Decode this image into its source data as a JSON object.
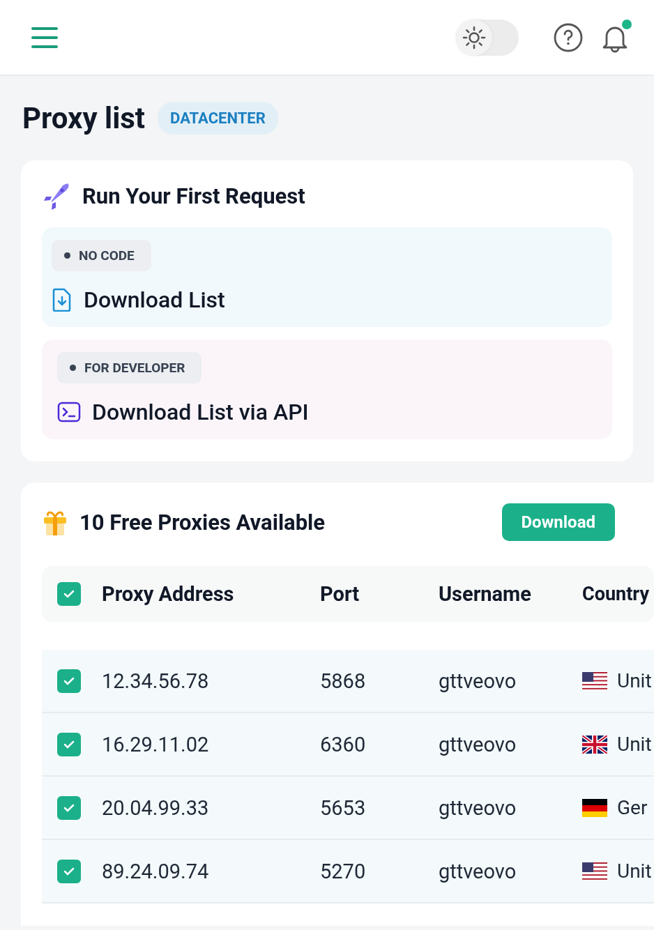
{
  "header": {
    "dark_mode": false,
    "notification_unread": true
  },
  "page_title": "Proxy list",
  "page_badge": "DATACENTER",
  "first_request": {
    "title": "Run Your First Request",
    "options": [
      {
        "kind": "file",
        "tag": "NO CODE",
        "label": "Download List"
      },
      {
        "kind": "api",
        "tag": "FOR DEVELOPER",
        "label": "Download List via API"
      }
    ]
  },
  "free_proxies": {
    "title": "10 Free Proxies Available",
    "download_button": "Download",
    "table": {
      "select_all": {
        "checked": true
      },
      "columns": [
        "Proxy Address",
        "Port",
        "Username",
        "Country"
      ],
      "rows": [
        {
          "checked": true,
          "address": "12.34.56.78",
          "port": "5868",
          "username": "gttveovo",
          "kind": "us",
          "country": "Unit"
        },
        {
          "checked": true,
          "address": "16.29.11.02",
          "port": "6360",
          "username": "gttveovo",
          "kind": "uk",
          "country": "Unit"
        },
        {
          "checked": true,
          "address": "20.04.99.33",
          "port": "5653",
          "username": "gttveovo",
          "kind": "de",
          "country": "Ger"
        },
        {
          "checked": true,
          "address": "89.24.09.74",
          "port": "5270",
          "username": "gttveovo",
          "kind": "us",
          "country": "Unit"
        }
      ]
    }
  }
}
